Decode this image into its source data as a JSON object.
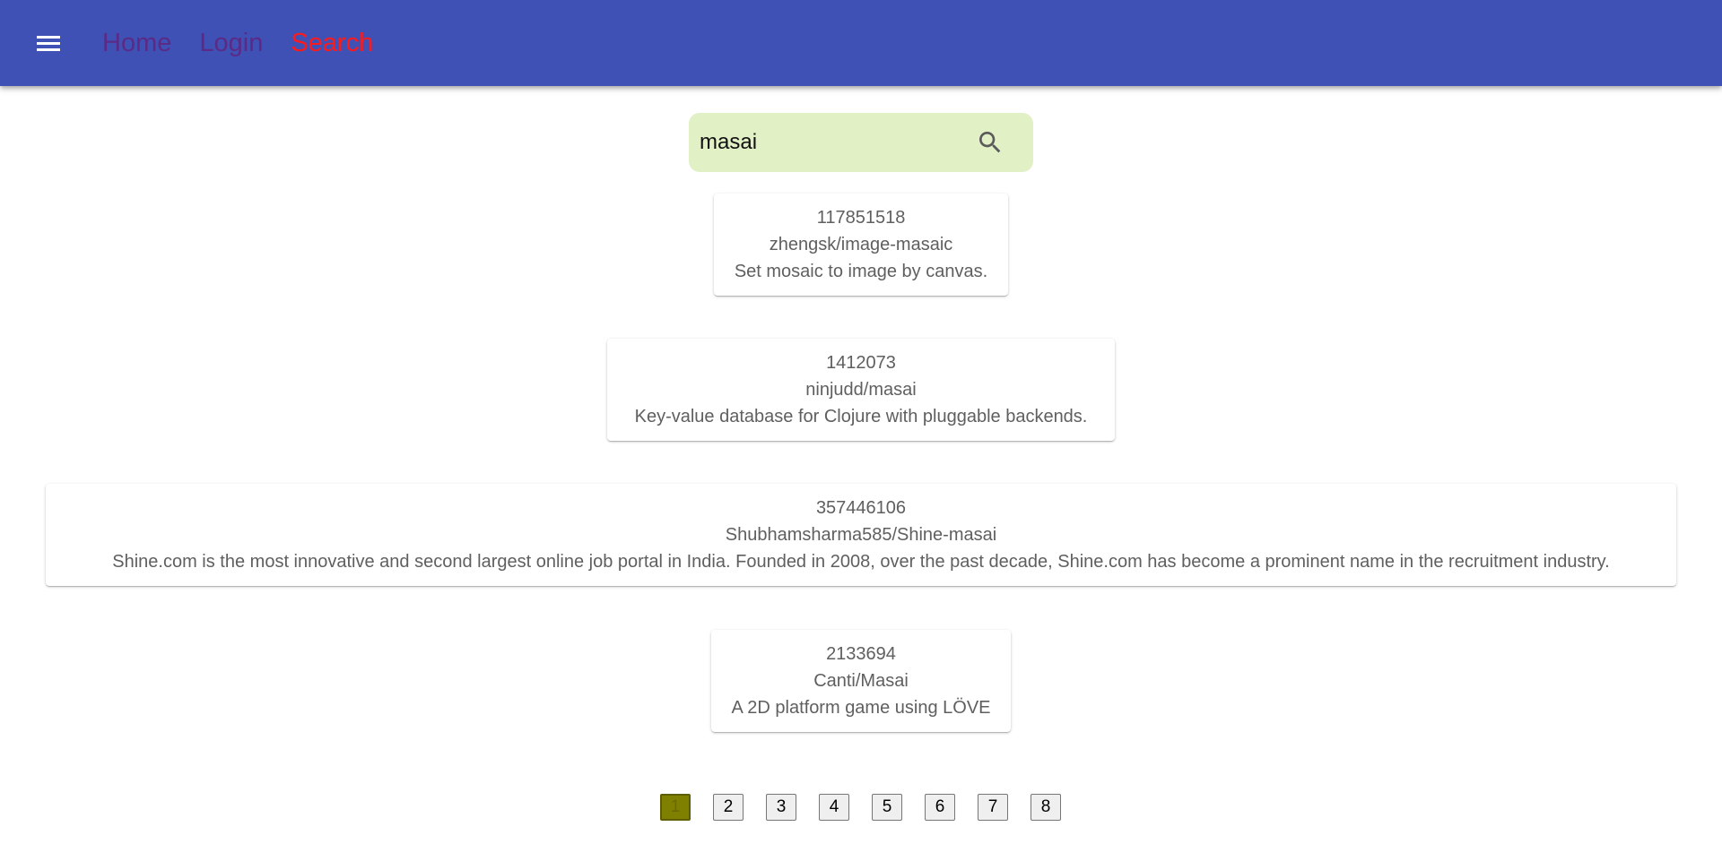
{
  "colors": {
    "appbar": "#3f51b5",
    "nav_visited": "#5b2a86",
    "nav_active": "#ff1a1a",
    "search_bg": "#e2f0c6",
    "page_current": "#808000"
  },
  "header": {
    "menu_icon": "hamburger-menu-icon",
    "nav": [
      {
        "label": "Home"
      },
      {
        "label": "Login"
      },
      {
        "label": "Search"
      }
    ]
  },
  "search": {
    "value": "masai",
    "icon": "search-icon"
  },
  "results": [
    {
      "id": "117851518",
      "name": "zhengsk/image-masaic",
      "description": "Set mosaic to image by canvas."
    },
    {
      "id": "1412073",
      "name": "ninjudd/masai",
      "description": "Key-value database for Clojure with pluggable backends."
    },
    {
      "id": "357446106",
      "name": "Shubhamsharma585/Shine-masai",
      "description": "Shine.com is the most innovative and second largest online job portal in India. Founded in 2008, over the past decade, Shine.com has become a prominent name in the recruitment industry."
    },
    {
      "id": "2133694",
      "name": "Canti/Masai",
      "description": "A 2D platform game using LÖVE"
    }
  ],
  "pagination": {
    "current": "1",
    "pages": [
      "1",
      "2",
      "3",
      "4",
      "5",
      "6",
      "7",
      "8"
    ]
  }
}
